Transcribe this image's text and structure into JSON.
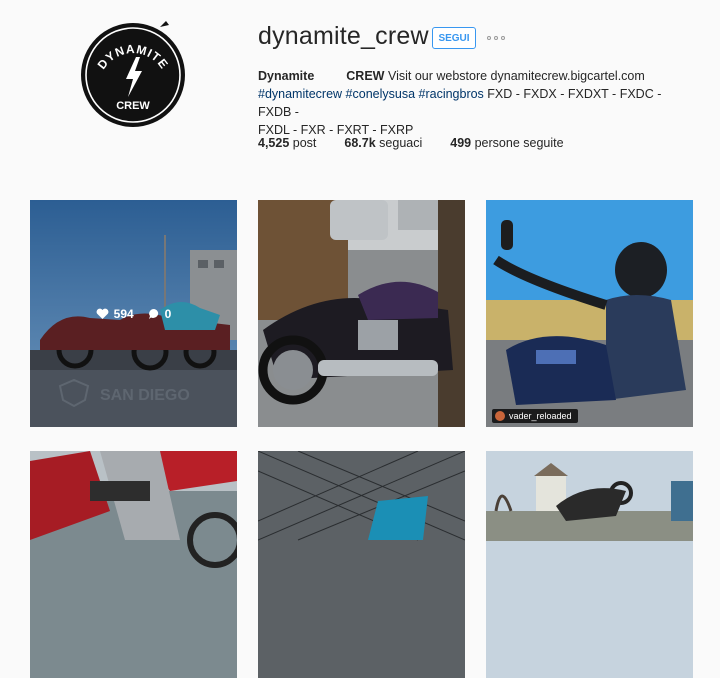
{
  "profile": {
    "username": "dynamite_crew",
    "follow_label": "SEGUI",
    "avatar_logo": {
      "line1": "DYNAMITE",
      "line2": "CREW"
    },
    "bio": {
      "name": "Dynamite",
      "crew": "CREW",
      "line1_rest": " Visit our webstore dynamitecrew.bigcartel.com",
      "hashtags": "#dynamitecrew #conelysusa #racingbros",
      "models_1": " FXD - FXDX - FXDXT - FXDC - FXDB -",
      "models_2": "FXDL - FXR - FXRT - FXRP"
    },
    "stats": {
      "posts_count": "4,525",
      "posts_label": "post",
      "followers_count": "68.7k",
      "followers_label": "seguaci",
      "following_count": "499",
      "following_label": "persone seguite"
    }
  },
  "posts": [
    {
      "likes": "594",
      "comments": "0",
      "watermark": "SAN DIEGO"
    },
    {},
    {
      "tagged_user": "vader_reloaded"
    },
    {},
    {},
    {}
  ],
  "colors": {
    "accent": "#3897f0",
    "background": "#fafafa"
  }
}
